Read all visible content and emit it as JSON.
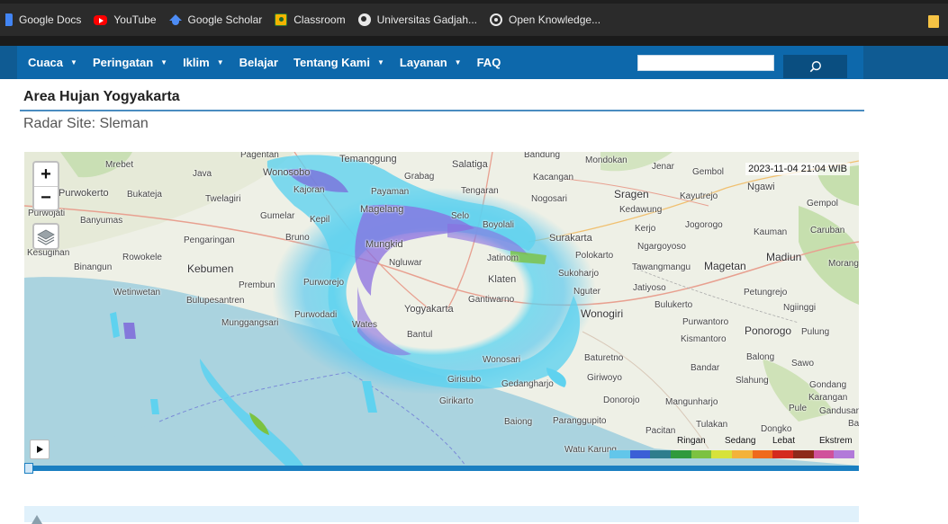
{
  "bookmarks": [
    {
      "label": "Google Docs",
      "icon": "google-docs-icon"
    },
    {
      "label": "YouTube",
      "icon": "youtube-icon"
    },
    {
      "label": "Google Scholar",
      "icon": "google-scholar-icon"
    },
    {
      "label": "Classroom",
      "icon": "classroom-icon"
    },
    {
      "label": "Universitas Gadjah...",
      "icon": "globe-icon"
    },
    {
      "label": "Open Knowledge...",
      "icon": "open-knowledge-icon"
    }
  ],
  "nav": {
    "items": [
      {
        "label": "Cuaca",
        "dropdown": true
      },
      {
        "label": "Peringatan",
        "dropdown": true
      },
      {
        "label": "Iklim",
        "dropdown": true
      },
      {
        "label": "Belajar",
        "dropdown": false
      },
      {
        "label": "Tentang Kami",
        "dropdown": true
      },
      {
        "label": "Layanan",
        "dropdown": true
      },
      {
        "label": "FAQ",
        "dropdown": false
      }
    ],
    "search_value": "",
    "caret": "▼"
  },
  "page": {
    "title": "Area Hujan Yogyakarta",
    "subtitle": "Radar Site: Sleman"
  },
  "map": {
    "timestamp": "2023-11-04 21:04 WIB",
    "zoom_in": "+",
    "zoom_out": "−",
    "legend": {
      "labels": [
        "Ringan",
        "Sedang",
        "Lebat",
        "Ekstrem"
      ],
      "colors": [
        "#62c6ea",
        "#3b5fd6",
        "#2e7d8c",
        "#2f9a3c",
        "#7cc241",
        "#d7e23a",
        "#f3b23a",
        "#ef6a1c",
        "#d42a1e",
        "#8d2a1a",
        "#d0529b",
        "#b27ad9"
      ]
    },
    "places": [
      "Pagentan",
      "Temanggung",
      "Salatiga",
      "Bandung",
      "Mondokan",
      "Jenar",
      "Gembol",
      "Ngawi",
      "Mrebet",
      "Java",
      "Wonosobo",
      "Grabag",
      "Kacangan",
      "Purwokerto",
      "Bukateja",
      "Twelagiri",
      "Kajoran",
      "Payaman",
      "Tengaran",
      "Nogosari",
      "Sragen",
      "Kayutrejo",
      "Gempol",
      "Purwojati",
      "Banyumas",
      "Gumelar",
      "Kepil",
      "Magelang",
      "Selo",
      "Boyolali",
      "Kedawung",
      "Kerjo",
      "Jogorogo",
      "Kauman",
      "Caruban",
      "Kesugihan",
      "Pengaringan",
      "Bruno",
      "Surakarta",
      "Ngargoyoso",
      "Rowokele",
      "Mungkid",
      "Ngluwar",
      "Jatinom",
      "Polokarto",
      "Tawangmangu",
      "Magetan",
      "Madiun",
      "Morang",
      "Binangun",
      "Kebumen",
      "Sukoharjo",
      "Prembun",
      "Purworejo",
      "Klaten",
      "Nguter",
      "Jatiyoso",
      "Petungrejo",
      "Wetinwetan",
      "Bulupesantren",
      "Gantiwarno",
      "Ngiinggi",
      "Yogyakarta",
      "Wonogiri",
      "Bulukerto",
      "Munggangsari",
      "Purwodadi",
      "Wates",
      "Bantul",
      "Purwantoro",
      "Kismantoro",
      "Ponorogo",
      "Pulung",
      "Baturetno",
      "Balong",
      "Sawo",
      "Giriwoyo",
      "Slahung",
      "Gondang",
      "Wonosari",
      "Donorojo",
      "Mangunharjo",
      "Karangan",
      "Gedangharjo",
      "Girikarto",
      "Pule",
      "Gandusari",
      "Baiong",
      "Paranggupito",
      "Tulakan",
      "Dongko",
      "Pacitan",
      "Watu Karung",
      "Bandar",
      "Girisubo",
      "Ba"
    ]
  }
}
